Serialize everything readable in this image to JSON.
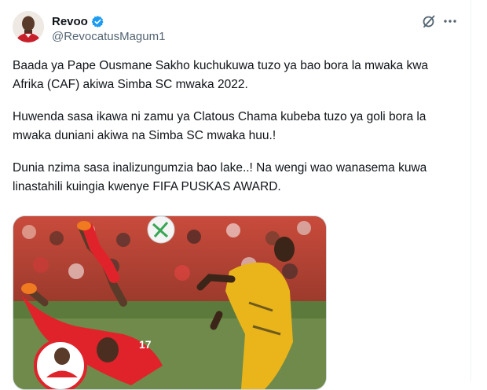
{
  "author": {
    "display_name": "Revoo",
    "handle": "@RevocatusMagum1",
    "verified": true,
    "verified_color": "#1d9bf0"
  },
  "actions": {
    "grok_icon": "grok-icon",
    "more_icon": "more-horizontal-icon"
  },
  "tweet": {
    "paragraphs": [
      "Baada ya Pape Ousmane Sakho kuchukuwa tuzo ya bao bora la mwaka kwa Afrika (CAF) akiwa Simba SC mwaka 2022.",
      "Huwenda sasa ikawa ni zamu ya Clatous Chama kubeba tuzo ya goli bora la mwaka duniani akiwa na Simba SC mwaka huu.!",
      "Dunia nzima sasa inalizungumzia bao lake..! Na wengi wao wanasema kuwa linastahili kuingia kwenye FIFA PUSKAS AWARD."
    ]
  },
  "media": {
    "kind": "photo",
    "shirt_number": "17",
    "colors": {
      "home_kit": "#e0232b",
      "away_kit": "#e9b51a",
      "pitch": "#6f8a4a"
    }
  }
}
